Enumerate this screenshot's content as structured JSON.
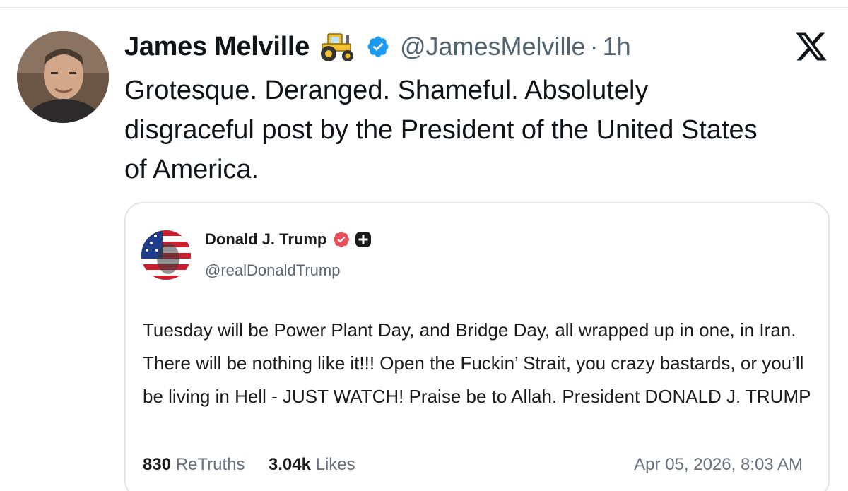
{
  "tweet": {
    "author": {
      "display_name": "James Melville",
      "emoji": "tractor-emoji",
      "handle": "@JamesMelville",
      "separator": "·",
      "time": "1h"
    },
    "text": "Grotesque. Deranged. Shameful. Absolutely disgraceful post by the President of the United States of America.",
    "platform_icon": "x-logo-icon",
    "colors": {
      "verified_blue": "#1d9bf0",
      "text_primary": "#0f1419",
      "text_secondary": "#536471"
    }
  },
  "quoted_post": {
    "author": {
      "display_name": "Donald J. Trump",
      "handle": "@realDonaldTrump"
    },
    "text": "Tuesday will be Power Plant Day, and Bridge Day, all wrapped up in one, in Iran. There will be nothing like it!!! Open the Fuckin’ Strait, you crazy bastards, or you’ll be living in Hell - JUST WATCH! Praise be to Allah. President DONALD J. TRUMP",
    "stats": {
      "retruths_count": "830",
      "retruths_label": "ReTruths",
      "likes_count": "3.04k",
      "likes_label": "Likes"
    },
    "timestamp": "Apr 05, 2026, 8:03 AM",
    "colors": {
      "verified_badge": "#e8505b"
    }
  }
}
